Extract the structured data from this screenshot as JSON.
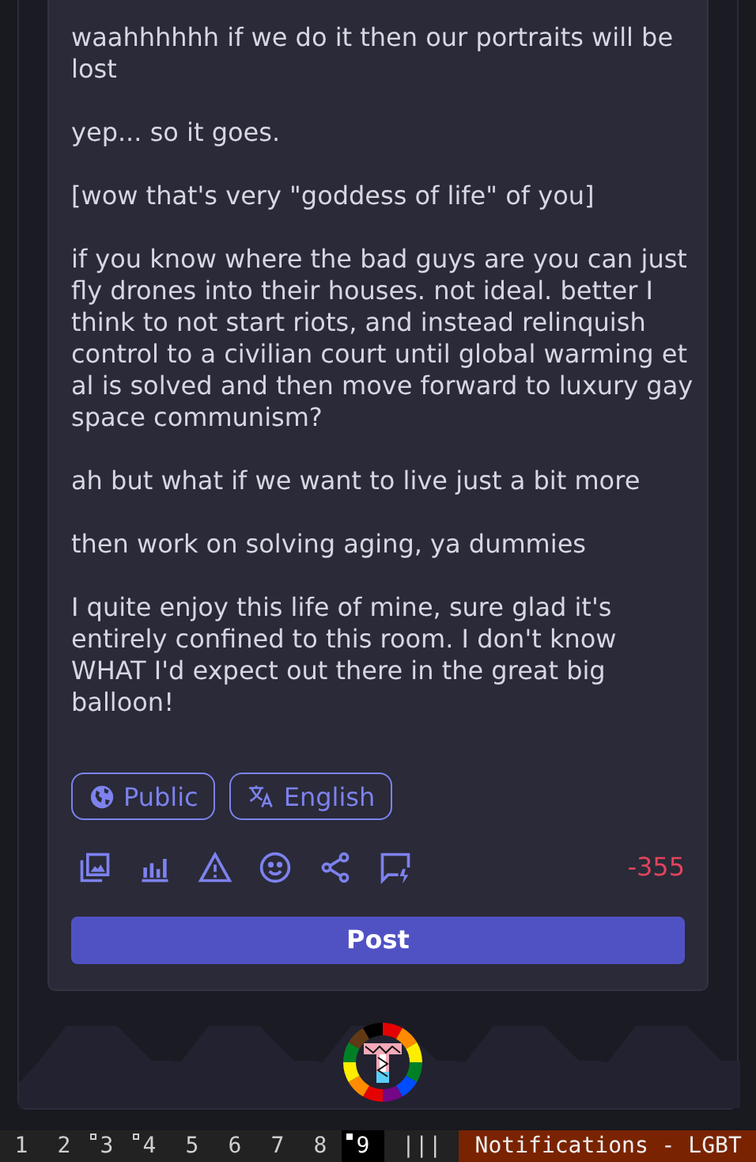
{
  "composer": {
    "text": "waahhhhhh if we do it then our portraits will be lost\n\nyep... so it goes.\n\n[wow that's very \"goddess of life\" of you]\n\nif you know where the bad guys are you can just fly drones into their houses. not ideal. better I think to not start riots, and instead relinquish control to a civilian court until global warming et al is solved and then move forward to luxury gay space communism?\n\nah but what if we want to live just a bit more\n\nthen work on solving aging, ya dummies\n\nI quite enjoy this life of mine, sure glad it's entirely confined to this room. I don't know WHAT I'd expect out there in the great big balloon!",
    "visibility": "Public",
    "language": "English",
    "tools": [
      {
        "kind": "media"
      },
      {
        "kind": "poll"
      },
      {
        "kind": "warning"
      },
      {
        "kind": "emoji"
      },
      {
        "kind": "share"
      },
      {
        "kind": "comment"
      }
    ],
    "character_count": "-355",
    "over_limit": true,
    "submit_label": "Post"
  },
  "status_bar": {
    "workspaces": [
      {
        "label": "1",
        "selected": false,
        "occupied": false
      },
      {
        "label": "2",
        "selected": false,
        "occupied": false
      },
      {
        "label": "3",
        "selected": false,
        "occupied": true
      },
      {
        "label": "4",
        "selected": false,
        "occupied": true
      },
      {
        "label": "5",
        "selected": false,
        "occupied": false
      },
      {
        "label": "6",
        "selected": false,
        "occupied": false
      },
      {
        "label": "7",
        "selected": false,
        "occupied": false
      },
      {
        "label": "8",
        "selected": false,
        "occupied": false
      },
      {
        "label": "9",
        "selected": true,
        "occupied": true
      }
    ],
    "layout": "|||",
    "window_title": "Notifications - LGBT"
  }
}
